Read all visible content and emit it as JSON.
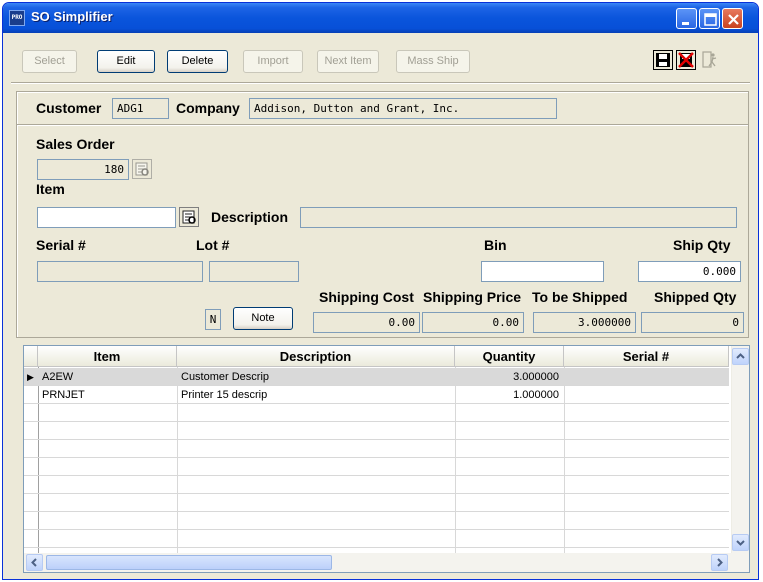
{
  "window": {
    "title": "SO Simplifier",
    "app_icon_text": "PRO"
  },
  "toolbar": {
    "buttons": [
      {
        "label": "Select",
        "enabled": false
      },
      {
        "label": "Edit",
        "enabled": true
      },
      {
        "label": "Delete",
        "enabled": true
      },
      {
        "label": "Import",
        "enabled": false
      },
      {
        "label": "Next Item",
        "enabled": false
      },
      {
        "label": "Mass Ship",
        "enabled": false
      }
    ],
    "icons": [
      "save-icon",
      "cancel-icon",
      "exit-icon"
    ]
  },
  "header": {
    "customer_label": "Customer",
    "customer_value": "ADG1",
    "company_label": "Company",
    "company_value": "Addison, Dutton and Grant, Inc."
  },
  "form": {
    "sales_order_label": "Sales Order",
    "sales_order_value": "180",
    "item_label": "Item",
    "item_value": "",
    "description_label": "Description",
    "description_value": "",
    "serial_label": "Serial #",
    "serial_value": "",
    "lot_label": "Lot #",
    "lot_value": "",
    "bin_label": "Bin",
    "bin_value": "",
    "ship_qty_label": "Ship Qty",
    "ship_qty_value": "0.000",
    "note_flag": "N",
    "note_button": "Note",
    "shipping_cost_label": "Shipping Cost",
    "shipping_cost_value": "0.00",
    "shipping_price_label": "Shipping Price",
    "shipping_price_value": "0.00",
    "to_be_shipped_label": "To be Shipped",
    "to_be_shipped_value": "3.000000",
    "shipped_qty_label": "Shipped Qty",
    "shipped_qty_value": "0"
  },
  "grid": {
    "columns": [
      "Item",
      "Description",
      "Quantity",
      "Serial #"
    ],
    "rows": [
      {
        "item": "A2EW",
        "description": "Customer Descrip",
        "quantity": "3.000000",
        "serial": "",
        "selected": true
      },
      {
        "item": "PRNJET",
        "description": "Printer 15 descrip",
        "quantity": "1.000000",
        "serial": "",
        "selected": false
      }
    ]
  },
  "colors": {
    "title_bar": "#0a55dc",
    "window_bg": "#ece9d8",
    "field_border": "#7f9db9"
  }
}
